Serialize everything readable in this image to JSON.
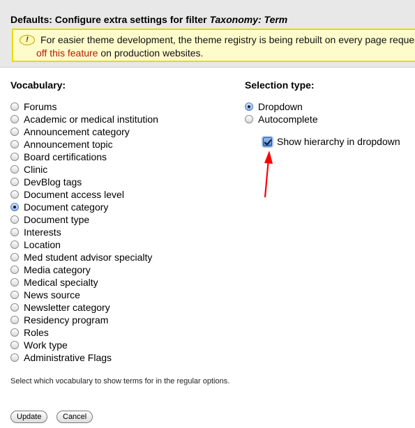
{
  "header": {
    "title_prefix": "Defaults: Configure extra settings for filter ",
    "title_emph": "Taxonomy: Term"
  },
  "warning": {
    "icon": "exclamation-icon",
    "text_line1": "For easier theme development, the theme registry is being rebuilt on every page reques",
    "link_text": "off this feature",
    "text_line2_rest": " on production websites."
  },
  "vocabulary": {
    "label": "Vocabulary:",
    "selected": "Document category",
    "options": [
      "Forums",
      "Academic or medical institution",
      "Announcement category",
      "Announcement topic",
      "Board certifications",
      "Clinic",
      "DevBlog tags",
      "Document access level",
      "Document category",
      "Document type",
      "Interests",
      "Location",
      "Med student advisor specialty",
      "Media category",
      "Medical specialty",
      "News source",
      "Newsletter category",
      "Residency program",
      "Roles",
      "Work type",
      "Administrative Flags"
    ],
    "help": "Select which vocabulary to show terms for in the regular options."
  },
  "selection_type": {
    "label": "Selection type:",
    "selected": "Dropdown",
    "options": [
      "Dropdown",
      "Autocomplete"
    ],
    "hierarchy_checkbox": {
      "label": "Show hierarchy in dropdown",
      "checked": true
    }
  },
  "buttons": {
    "update": "Update",
    "cancel": "Cancel"
  },
  "colors": {
    "warning_bg": "#fffccc",
    "warning_border": "#e5dc00",
    "link": "#b41e00",
    "arrow": "#ff0000"
  }
}
